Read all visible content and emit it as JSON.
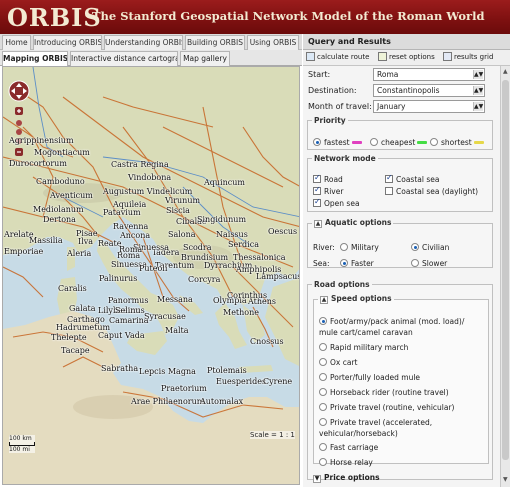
{
  "header": {
    "logo": "ORBIS",
    "subtitle_a": "The Stanford Geospatial Network Model of the Roman World"
  },
  "top_tabs": [
    "Home",
    "Introducing ORBIS",
    "Understanding ORBIS",
    "Building ORBIS",
    "Using ORBIS"
  ],
  "sub_tabs": [
    "Mapping ORBIS",
    "Interactive distance cartogram",
    "Map gallery"
  ],
  "map": {
    "places": [
      "Agrippinensium",
      "Mogontiacum",
      "Durocortorum",
      "Castra Regina",
      "Vindobona",
      "Aquincum",
      "Camboduno",
      "Aventicum",
      "Augustum Vindelicum",
      "Aquileia",
      "Virunum",
      "Mediolanum",
      "Patavium",
      "Siscia",
      "Cibalae",
      "Singidunum",
      "Dertona",
      "Ravenna",
      "Salona",
      "Naissus",
      "Arelate",
      "Massilia",
      "Pisae",
      "Ancona",
      "Scodra",
      "Serdica",
      "Aleria",
      "Reate",
      "Roma",
      "Iadera",
      "Oescus",
      "Emporiae",
      "Ilva",
      "Sinuessa",
      "Brundisium",
      "Thessalonica",
      "Roma",
      "Tarentum",
      "Dyrrachium",
      "Caralis",
      "Sinuessa",
      "Puteoli",
      "Amphipolis",
      "Palinurus",
      "Messana",
      "Corcyra",
      "Athens",
      "Panormus",
      "Lilybaeum",
      "Olympia",
      "Syracusae",
      "Methone",
      "Galata",
      "Carthago",
      "Selinus",
      "Camarina",
      "Corinthus",
      "Hadrumetum",
      "Lampsacus",
      "Malta",
      "Thelepte",
      "Caput Vada",
      "Tacape",
      "Cnossus",
      "Sabratha",
      "Lepcis Magna",
      "Ptolemais",
      "Euesperides",
      "Cyrene",
      "Arae Philaenorum",
      "Praetorium",
      "Automalax"
    ],
    "scale_km": "100 km",
    "scale_mi": "100 mi",
    "scale_text": "Scale = 1 : 1"
  },
  "panel": {
    "title": "Query and Results",
    "toolbar": {
      "calculate": "calculate route",
      "reset": "reset options",
      "grid": "results grid"
    },
    "start_label": "Start:",
    "start_value": "Roma",
    "dest_label": "Destination:",
    "dest_value": "Constantinopolis",
    "month_label": "Month of travel:",
    "month_value": "January",
    "priority": {
      "legend": "Priority",
      "fastest": "fastest",
      "cheapest": "cheapest",
      "shortest": "shortest",
      "fastest_color": "#e040c0",
      "cheapest_color": "#44dd44",
      "shortest_color": "#e6d84a"
    },
    "network": {
      "legend": "Network mode",
      "road": "Road",
      "river": "River",
      "open_sea": "Open sea",
      "coastal": "Coastal sea",
      "coastal_day": "Coastal sea (daylight)"
    },
    "aquatic": {
      "legend": "Aquatic options",
      "river_label": "River:",
      "military": "Military",
      "civilian": "Civilian",
      "sea_label": "Sea:",
      "faster": "Faster",
      "slower": "Slower"
    },
    "road": {
      "legend": "Road options",
      "speed_legend": "Speed options",
      "options": [
        "Foot/army/pack animal (mod. load)/ mule cart/camel caravan",
        "Rapid military march",
        "Ox cart",
        "Porter/fully loaded mule",
        "Horseback rider (routine travel)",
        "Private travel (routine, vehicular)",
        "Private travel (accelerated, vehicular/horseback)",
        "Fast carriage",
        "Horse relay"
      ],
      "price_legend": "Price options"
    }
  }
}
